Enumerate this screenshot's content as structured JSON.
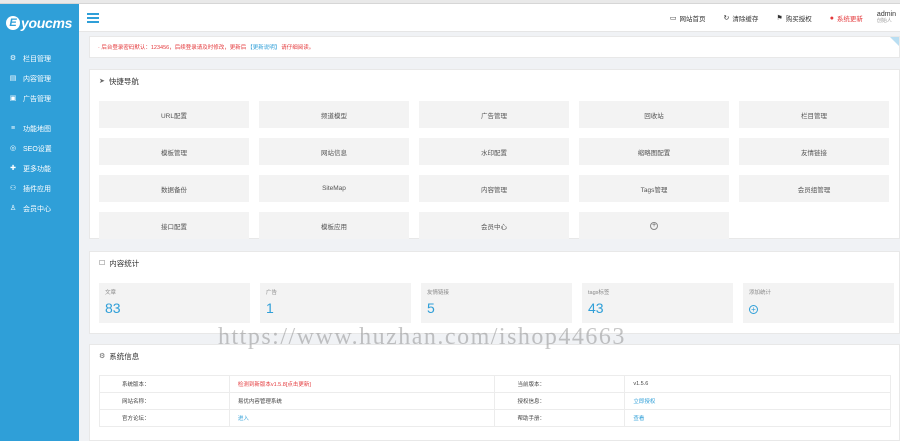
{
  "brand": {
    "mark": "E",
    "name": "youcms"
  },
  "sidebar": {
    "items": [
      {
        "icon": "gear-icon",
        "glyph": "⚙",
        "label": "栏目管理"
      },
      {
        "icon": "file-icon",
        "glyph": "▤",
        "label": "内容管理"
      },
      {
        "icon": "image-icon",
        "glyph": "▣",
        "label": "广告管理"
      },
      {
        "icon": "bars-icon",
        "glyph": "≡",
        "label": "功能地图"
      },
      {
        "icon": "seo-icon",
        "glyph": "◎",
        "label": "SEO设置"
      },
      {
        "icon": "puzzle-icon",
        "glyph": "✚",
        "label": "更多功能"
      },
      {
        "icon": "plugin-icon",
        "glyph": "⚇",
        "label": "插件应用"
      },
      {
        "icon": "user-icon",
        "glyph": "♙",
        "label": "会员中心"
      }
    ]
  },
  "topbar": {
    "actions": [
      {
        "icon": "monitor-icon",
        "glyph": "▭",
        "label": "网站首页"
      },
      {
        "icon": "refresh-icon",
        "glyph": "↻",
        "label": "清除缓存"
      },
      {
        "icon": "flag-icon",
        "glyph": "⚑",
        "label": "购买授权"
      },
      {
        "icon": "alert-icon",
        "glyph": "●",
        "label": "系统更新"
      }
    ],
    "user": {
      "name": "admin",
      "role": "创始人"
    }
  },
  "notice": {
    "prefix": "· 后台登录密码默认：123456，后续登录请及时修改，更新后",
    "link": "【更新说明】",
    "suffix": "请仔细阅读。"
  },
  "quick_nav": {
    "title": "快捷导航",
    "items": [
      "URL配置",
      "频道模型",
      "广告管理",
      "回收站",
      "栏目管理",
      "模板管理",
      "网站信息",
      "水印配置",
      "缩略图配置",
      "友情链接",
      "数据备份",
      "SiteMap",
      "内容管理",
      "Tags管理",
      "会员组管理",
      "接口配置",
      "模板应用",
      "会员中心"
    ],
    "add_glyph": "+"
  },
  "content_stats": {
    "title": "内容统计",
    "items": [
      {
        "label": "文章",
        "value": "83"
      },
      {
        "label": "广告",
        "value": "1"
      },
      {
        "label": "友情链接",
        "value": "5"
      },
      {
        "label": "tags标签",
        "value": "43"
      }
    ],
    "add_label": "添加统计",
    "add_glyph": "+"
  },
  "system_info": {
    "title": "系统信息",
    "rows": [
      {
        "k1": "系统版本：",
        "v1": "检测到新版本v1.5.8[点击更新]",
        "k2": "当前版本：",
        "v2": "v1.5.6"
      },
      {
        "k1": "网站名称：",
        "v1": "易优内容管理系统",
        "k2": "授权信息：",
        "v2": "立即授权"
      },
      {
        "k1": "官方论坛：",
        "v1": "进入",
        "k2": "帮助手册：",
        "v2": "查看"
      }
    ]
  },
  "watermark": "https://www.huzhan.com/ishop44663"
}
